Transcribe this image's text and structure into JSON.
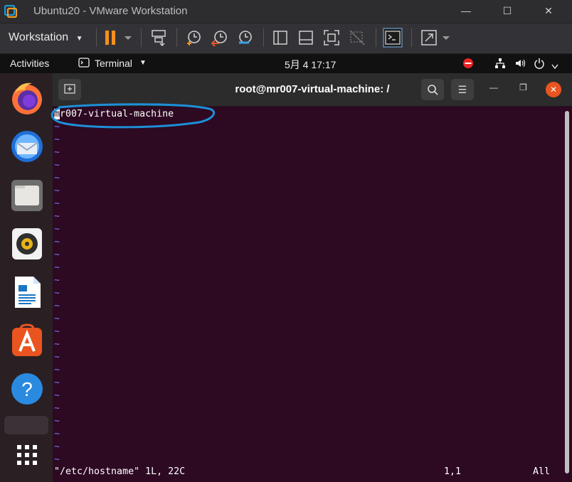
{
  "vmware": {
    "title": "Ubuntu20 - VMware Workstation",
    "menu_label": "Workstation",
    "menu_arrow": "▼",
    "minimize": "—",
    "maximize": "☐",
    "close": "✕"
  },
  "ubuntu_topbar": {
    "activities": "Activities",
    "app_menu": "Terminal",
    "app_menu_arrow": "▼",
    "clock": "5月 4  17:17"
  },
  "dock": {
    "items": [
      "firefox",
      "thunderbird",
      "files",
      "rhythmbox",
      "libreoffice-writer",
      "ubuntu-software",
      "help",
      "show-applications"
    ]
  },
  "terminal": {
    "title": "root@mr007-virtual-machine: /",
    "new_tab_icon": "+",
    "search_icon": "search",
    "menu_icon": "☰",
    "minimize": "—",
    "restore": "❐",
    "close": "✕"
  },
  "editor": {
    "cursor_char": "m",
    "first_line_rest": "r007-virtual-machine",
    "tilde": "~",
    "tilde_count": 27,
    "status_file": "\"/etc/hostname\" 1L, 22C",
    "status_pos": "1,1",
    "status_scroll": "All"
  },
  "colors": {
    "terminal_bg": "#2d0922",
    "tilde": "#7777ff",
    "annotation": "#1e8fd8",
    "close_orange": "#e95420"
  }
}
